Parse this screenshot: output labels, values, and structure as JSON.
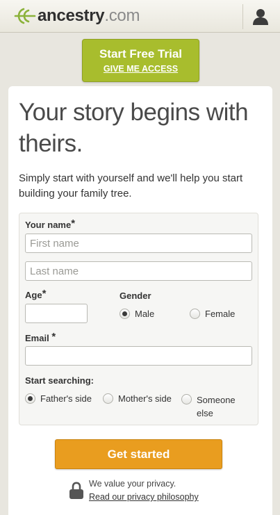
{
  "header": {
    "logo_text": "ancestry",
    "logo_suffix": ".com"
  },
  "trial": {
    "title": "Start Free Trial",
    "subtitle": "GIVE ME ACCESS"
  },
  "main": {
    "headline": "Your story begins with theirs.",
    "intro": "Simply start with yourself and we'll help you start building your family tree."
  },
  "form": {
    "name_label": "Your name",
    "required_mark": "*",
    "first_name_placeholder": "First name",
    "last_name_placeholder": "Last name",
    "first_name_value": "",
    "last_name_value": "",
    "age_label": "Age",
    "age_value": "",
    "gender_label": "Gender",
    "gender_options": [
      "Male",
      "Female"
    ],
    "gender_selected": "Male",
    "email_label": "Email",
    "email_value": "",
    "search_label": "Start searching:",
    "search_options": [
      "Father's side",
      "Mother's side",
      "Someone else"
    ],
    "search_selected": "Father's side",
    "submit_label": "Get started"
  },
  "privacy": {
    "text": "We value your privacy.",
    "link": "Read our privacy philosophy"
  },
  "colors": {
    "trial_green": "#a8bd2d",
    "cta_orange": "#e99d1f",
    "logo_leaf": "#8bb23a"
  }
}
